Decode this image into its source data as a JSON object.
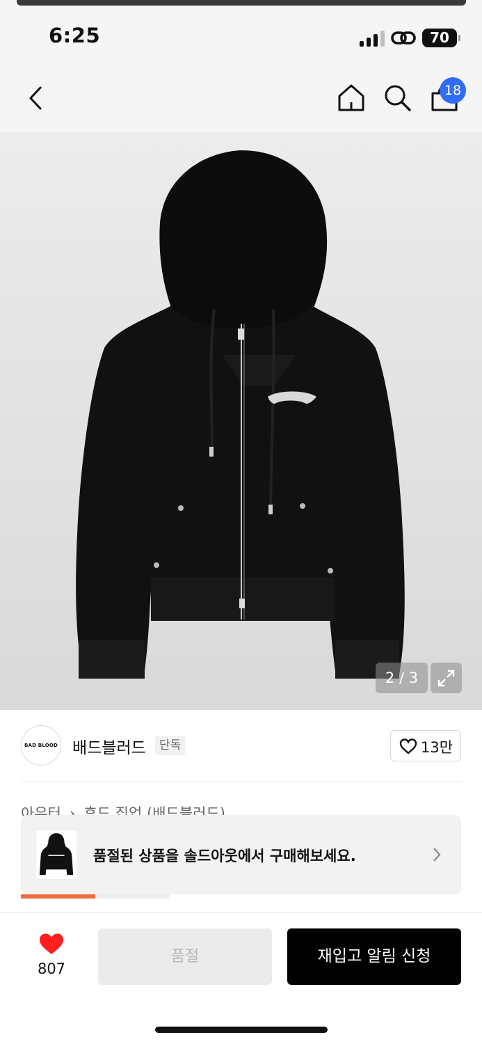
{
  "status_bar": {
    "time": "6:25",
    "battery": "70"
  },
  "nav": {
    "cart_count": "18"
  },
  "gallery": {
    "counter": "2 / 3"
  },
  "brand": {
    "logo_text": "BAD BLOOD",
    "name": "배드블러드",
    "tag": "단독"
  },
  "likes": {
    "count": "13만"
  },
  "breadcrumb": {
    "category": "아우터",
    "subcategory": "후드 집업 (배드블러드)"
  },
  "toast": {
    "message": "품절된 상품을 솔드아웃에서 구매해보세요."
  },
  "tab_progress": 0.5,
  "bottom_bar": {
    "wishlist_count": "807",
    "soldout_label": "품절",
    "restock_label": "재입고 알림 신청"
  },
  "colors": {
    "badge": "#2f6df6",
    "heart": "#ff1f1f",
    "progress": "#f06b3f",
    "primary_button": "#000000"
  }
}
